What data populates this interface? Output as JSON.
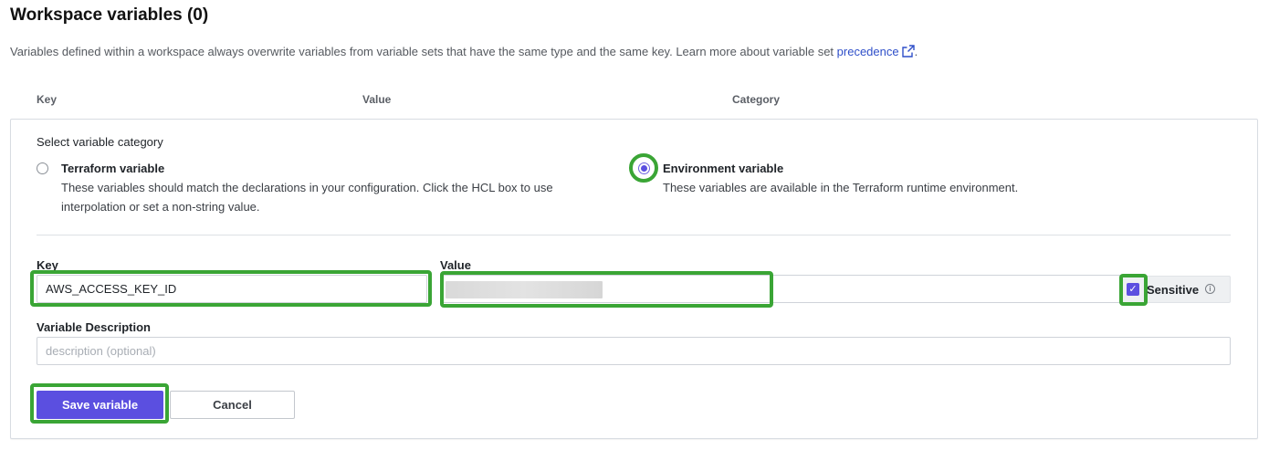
{
  "colors": {
    "accent": "#5b4fe0",
    "highlight": "#3aa535",
    "link": "#2f4fc9"
  },
  "header": {
    "title": "Workspace variables (0)",
    "intro_text": "Variables defined within a workspace always overwrite variables from variable sets that have the same type and the same key. Learn more about variable set ",
    "intro_link": "precedence",
    "intro_link_icon": "external-link-icon",
    "intro_end": "."
  },
  "table": {
    "columns": [
      "Key",
      "Value",
      "Category"
    ]
  },
  "form": {
    "category_title": "Select variable category",
    "options": [
      {
        "label": "Terraform variable",
        "desc_line1": "These variables should match the declarations in your configuration. Click the HCL box to use",
        "desc_line2": "interpolation or set a non-string value.",
        "selected": false
      },
      {
        "label": "Environment variable",
        "desc_line1": "These variables are available in the Terraform runtime environment.",
        "selected": true
      }
    ],
    "key_label": "Key",
    "key_value": "AWS_ACCESS_KEY_ID",
    "value_label": "Value",
    "value_masked": true,
    "sensitive_label": "Sensitive",
    "sensitive_checked": true,
    "info_icon": "info-icon",
    "description_label": "Variable Description",
    "description_placeholder": "description (optional)",
    "save_label": "Save variable",
    "cancel_label": "Cancel"
  }
}
